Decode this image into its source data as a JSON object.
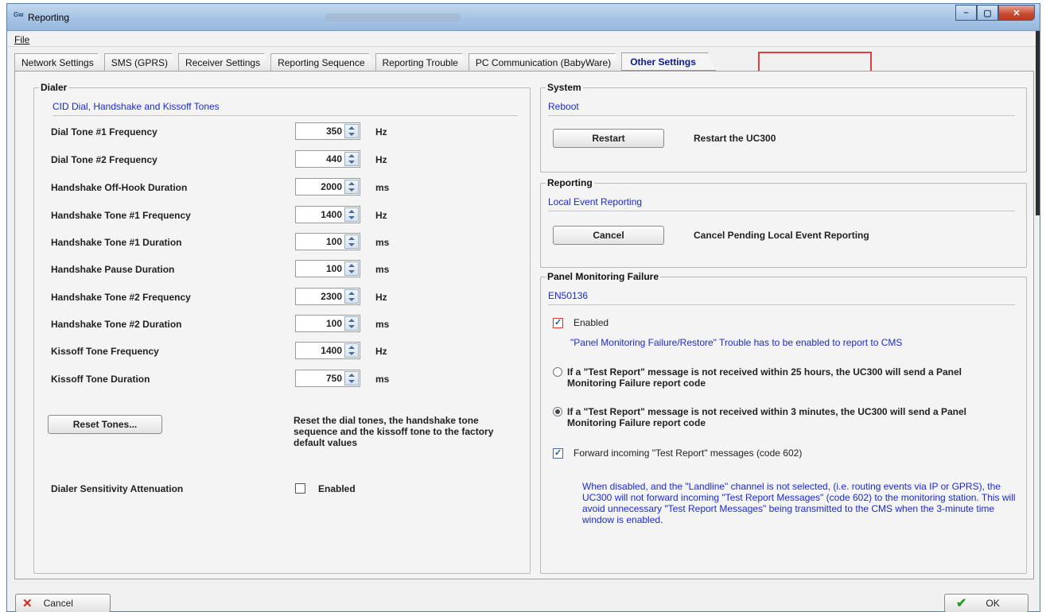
{
  "window": {
    "title": "Reporting",
    "icon_label": "Gw",
    "colors": {
      "accent_blue": "#1b2bd6",
      "highlight_red": "#e0403b",
      "close_red": "#c74a30"
    }
  },
  "menu": {
    "file": "File"
  },
  "tabs": [
    {
      "label": "Network Settings",
      "active": false
    },
    {
      "label": "SMS (GPRS)",
      "active": false
    },
    {
      "label": "Receiver Settings",
      "active": false
    },
    {
      "label": "Reporting Sequence",
      "active": false
    },
    {
      "label": "Reporting Trouble",
      "active": false
    },
    {
      "label": "PC Communication (BabyWare)",
      "active": false
    },
    {
      "label": "Other Settings",
      "active": true
    }
  ],
  "dialer": {
    "group_title": "Dialer",
    "subtitle": "CID Dial, Handshake and Kissoff Tones",
    "rows": [
      {
        "label": "Dial Tone #1 Frequency",
        "value": "350",
        "unit": "Hz"
      },
      {
        "label": "Dial Tone #2 Frequency",
        "value": "440",
        "unit": "Hz"
      },
      {
        "label": "Handshake Off-Hook Duration",
        "value": "2000",
        "unit": "ms"
      },
      {
        "label": "Handshake Tone #1 Frequency",
        "value": "1400",
        "unit": "Hz"
      },
      {
        "label": "Handshake Tone #1 Duration",
        "value": "100",
        "unit": "ms"
      },
      {
        "label": "Handshake Pause Duration",
        "value": "100",
        "unit": "ms"
      },
      {
        "label": "Handshake Tone #2 Frequency",
        "value": "2300",
        "unit": "Hz"
      },
      {
        "label": "Handshake Tone #2 Duration",
        "value": "100",
        "unit": "ms"
      },
      {
        "label": "Kissoff Tone Frequency",
        "value": "1400",
        "unit": "Hz"
      },
      {
        "label": "Kissoff Tone Duration",
        "value": "750",
        "unit": "ms"
      }
    ],
    "reset_button": "Reset Tones...",
    "reset_desc": "Reset the dial tones, the handshake tone sequence and the kissoff tone to the factory default values",
    "sensitivity_label": "Dialer Sensitivity Attenuation",
    "sensitivity_checkbox_label": "Enabled",
    "sensitivity_checked": false
  },
  "system": {
    "group_title": "System",
    "subtitle": "Reboot",
    "button": "Restart",
    "desc": "Restart the UC300"
  },
  "reporting": {
    "group_title": "Reporting",
    "subtitle": "Local Event Reporting",
    "button": "Cancel",
    "desc": "Cancel Pending Local Event Reporting"
  },
  "panel_monitoring": {
    "group_title": "Panel Monitoring Failure",
    "subtitle": "EN50136",
    "enabled_label": "Enabled",
    "enabled_checked": true,
    "enabled_note": "\"Panel Monitoring Failure/Restore\" Trouble has to be enabled to report to CMS",
    "option_25h": "If a \"Test Report\" message is not received within 25 hours, the UC300 will send a Panel Monitoring Failure report code",
    "option_3min": "If a \"Test Report\" message is not received within 3 minutes, the UC300 will send a Panel Monitoring Failure report code",
    "selected_option": "3min",
    "forward_label": "Forward incoming \"Test Report\" messages (code 602)",
    "forward_checked": true,
    "forward_note": "When disabled, and the \"Landline\" channel is not selected, (i.e. routing events via IP or GPRS), the UC300 will not forward incoming \"Test Report Messages\" (code 602) to the monitoring station. This will avoid unnecessary \"Test Report Messages\" being transmitted to the CMS when the 3-minute time window is enabled."
  },
  "footer": {
    "cancel": "Cancel",
    "ok": "OK"
  }
}
